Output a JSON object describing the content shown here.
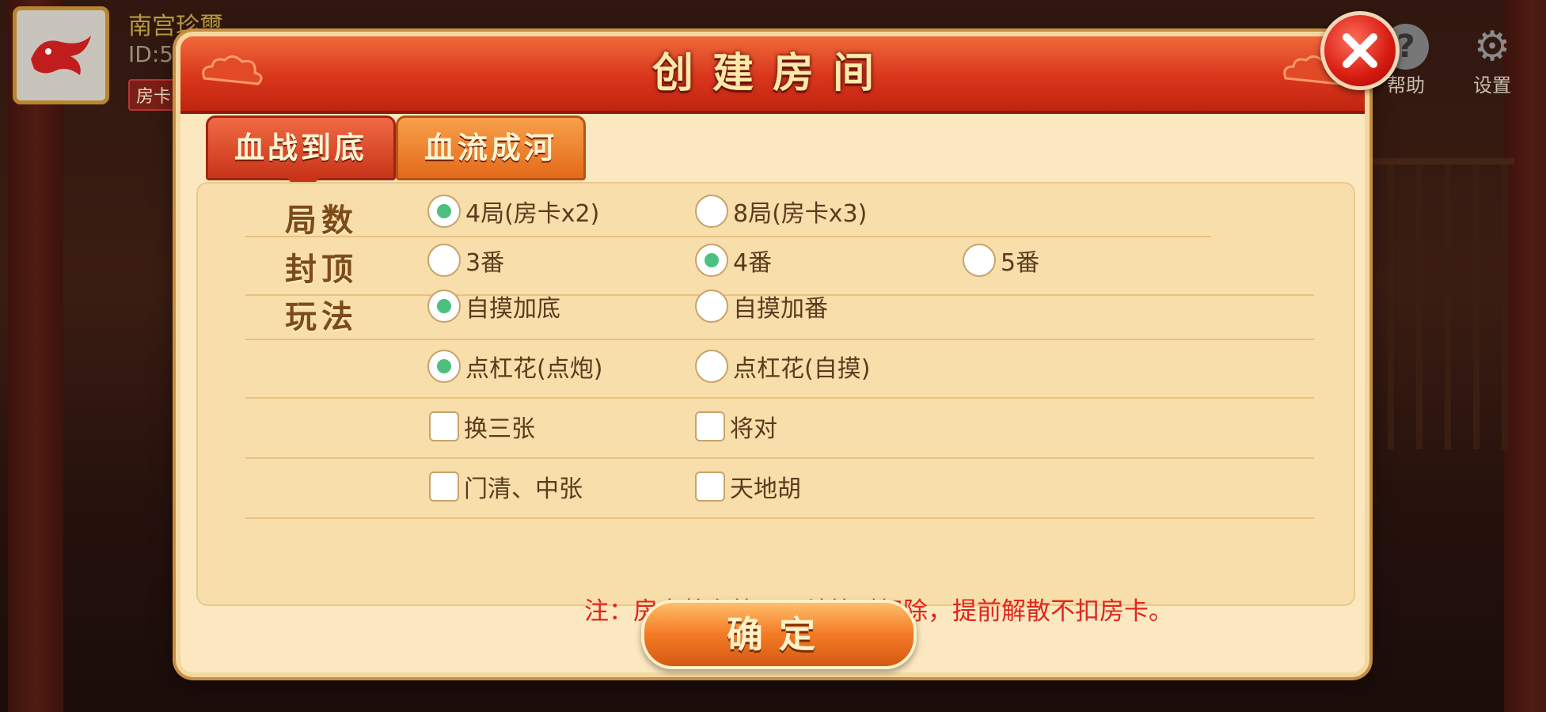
{
  "player": {
    "name": "南宫珍璽",
    "id_text": "ID:59",
    "room_card_tag": "房卡"
  },
  "top_buttons": {
    "help_label": "帮助",
    "settings_label": "设置"
  },
  "dialog": {
    "title": "创建房间",
    "tabs": [
      {
        "label": "血战到底",
        "active": true
      },
      {
        "label": "血流成河",
        "active": false
      }
    ],
    "rows": {
      "rounds": {
        "label": "局数",
        "options": [
          {
            "label": "4局(房卡x2)",
            "selected": true
          },
          {
            "label": "8局(房卡x3)",
            "selected": false
          }
        ]
      },
      "cap": {
        "label": "封顶",
        "options": [
          {
            "label": "3番",
            "selected": false
          },
          {
            "label": "4番",
            "selected": true
          },
          {
            "label": "5番",
            "selected": false
          }
        ]
      },
      "play": {
        "label": "玩法",
        "options_a": [
          {
            "label": "自摸加底",
            "selected": true
          },
          {
            "label": "自摸加番",
            "selected": false
          }
        ],
        "options_b": [
          {
            "label": "点杠花(点炮)",
            "selected": true
          },
          {
            "label": "点杠花(自摸)",
            "selected": false
          }
        ],
        "checkboxes_a": [
          {
            "label": "换三张",
            "checked": false
          },
          {
            "label": "将对",
            "checked": false
          }
        ],
        "checkboxes_b": [
          {
            "label": "门清、中张",
            "checked": false
          },
          {
            "label": "天地胡",
            "checked": false
          }
        ]
      }
    },
    "note": "注：房卡将在第一局结算时扣除，提前解散不扣房卡。",
    "confirm_label": "确定"
  },
  "colors": {
    "header_red": "#d9361c",
    "panel_bg": "#fbe8c0",
    "radio_selected": "#4cc07e",
    "note_red": "#e2261b"
  }
}
